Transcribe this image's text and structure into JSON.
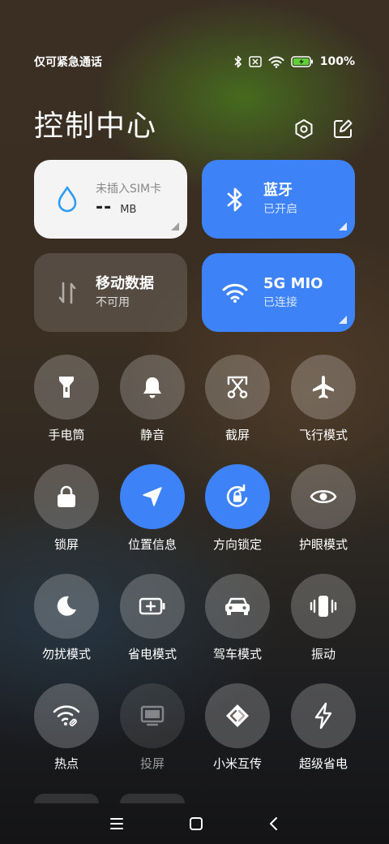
{
  "status_bar": {
    "carrier": "仅可紧急通话",
    "battery_percent": "100%",
    "icons": [
      "bluetooth-icon",
      "no-sim-icon",
      "wifi-icon",
      "battery-charging-icon"
    ]
  },
  "header": {
    "title": "控制中心",
    "icons": [
      "settings-icon",
      "edit-icon"
    ]
  },
  "tiles": {
    "data_usage": {
      "label": "未插入SIM卡",
      "value": "--",
      "unit": "MB",
      "icon": "water-drop-icon"
    },
    "bluetooth": {
      "label": "蓝牙",
      "status": "已开启",
      "icon": "bluetooth-icon"
    },
    "mobile_data": {
      "label": "移动数据",
      "status": "不可用",
      "icon": "mobile-data-arrows-icon"
    },
    "wifi": {
      "label": "5G    MIO",
      "status": "已连接",
      "icon": "wifi-icon"
    }
  },
  "toggles": [
    {
      "label": "手电筒",
      "icon": "flashlight-icon",
      "state": "off"
    },
    {
      "label": "静音",
      "icon": "bell-icon",
      "state": "off"
    },
    {
      "label": "截屏",
      "icon": "screenshot-scissors-icon",
      "state": "off"
    },
    {
      "label": "飞行模式",
      "icon": "airplane-icon",
      "state": "off"
    },
    {
      "label": "锁屏",
      "icon": "lock-icon",
      "state": "off"
    },
    {
      "label": "位置信息",
      "icon": "location-arrow-icon",
      "state": "on"
    },
    {
      "label": "方向锁定",
      "icon": "rotation-lock-icon",
      "state": "on"
    },
    {
      "label": "护眼模式",
      "icon": "eye-icon",
      "state": "off"
    },
    {
      "label": "勿扰模式",
      "icon": "moon-icon",
      "state": "off"
    },
    {
      "label": "省电模式",
      "icon": "battery-saver-icon",
      "state": "off"
    },
    {
      "label": "驾车模式",
      "icon": "car-icon",
      "state": "off"
    },
    {
      "label": "振动",
      "icon": "vibrate-icon",
      "state": "off"
    },
    {
      "label": "热点",
      "icon": "hotspot-icon",
      "state": "off"
    },
    {
      "label": "投屏",
      "icon": "cast-screen-icon",
      "state": "disabled"
    },
    {
      "label": "小米互传",
      "icon": "mi-share-icon",
      "state": "off"
    },
    {
      "label": "超级省电",
      "icon": "lightning-icon",
      "state": "off"
    }
  ],
  "nav_bar": {
    "icons": [
      "menu-icon",
      "home-icon",
      "back-icon"
    ]
  },
  "colors": {
    "accent": "#3e82f7",
    "data_tile": "#f4f4f4"
  }
}
